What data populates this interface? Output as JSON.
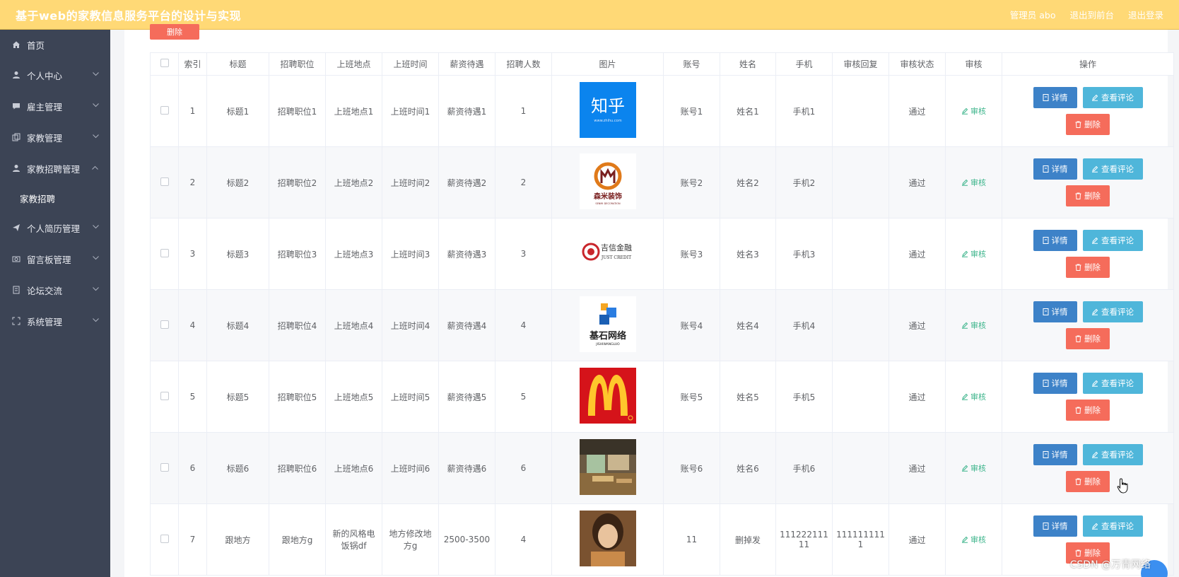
{
  "header": {
    "title": "基于web的家教信息服务平台的设计与实现",
    "user": "管理员 abo",
    "frontend": "退出到前台",
    "logout": "退出登录"
  },
  "sidebar": {
    "items": [
      {
        "label": "首页",
        "icon": "home-icon"
      },
      {
        "label": "个人中心",
        "icon": "user-icon"
      },
      {
        "label": "雇主管理",
        "icon": "chat-icon"
      },
      {
        "label": "家教管理",
        "icon": "copy-icon"
      },
      {
        "label": "家教招聘管理",
        "icon": "user-icon",
        "open": true,
        "children": [
          "家教招聘"
        ]
      },
      {
        "label": "个人简历管理",
        "icon": "send-icon"
      },
      {
        "label": "留言板管理",
        "icon": "camera-icon"
      },
      {
        "label": "论坛交流",
        "icon": "building-icon"
      },
      {
        "label": "系统管理",
        "icon": "scan-icon"
      }
    ]
  },
  "table": {
    "top_delete_label": "删除",
    "headers": [
      "索引",
      "标题",
      "招聘职位",
      "上班地点",
      "上班时间",
      "薪资待遇",
      "招聘人数",
      "图片",
      "账号",
      "姓名",
      "手机",
      "审核回复",
      "审核状态",
      "审核",
      "操作"
    ],
    "rows": [
      {
        "index": "1",
        "title": "标题1",
        "position": "招聘职位1",
        "location": "上班地点1",
        "time": "上班时间1",
        "salary": "薪资待遇1",
        "count": "1",
        "image": "zhihu-logo",
        "account": "账号1",
        "name": "姓名1",
        "phone": "手机1",
        "reply": "",
        "status": "通过"
      },
      {
        "index": "2",
        "title": "标题2",
        "position": "招聘职位2",
        "location": "上班地点2",
        "time": "上班时间2",
        "salary": "薪资待遇2",
        "count": "2",
        "image": "decoration-logo",
        "account": "账号2",
        "name": "姓名2",
        "phone": "手机2",
        "reply": "",
        "status": "通过"
      },
      {
        "index": "3",
        "title": "标题3",
        "position": "招聘职位3",
        "location": "上班地点3",
        "time": "上班时间3",
        "salary": "薪资待遇3",
        "count": "3",
        "image": "just-credit-logo",
        "account": "账号3",
        "name": "姓名3",
        "phone": "手机3",
        "reply": "",
        "status": "通过"
      },
      {
        "index": "4",
        "title": "标题4",
        "position": "招聘职位4",
        "location": "上班地点4",
        "time": "上班时间4",
        "salary": "薪资待遇4",
        "count": "4",
        "image": "jishi-logo",
        "account": "账号4",
        "name": "姓名4",
        "phone": "手机4",
        "reply": "",
        "status": "通过"
      },
      {
        "index": "5",
        "title": "标题5",
        "position": "招聘职位5",
        "location": "上班地点5",
        "time": "上班时间5",
        "salary": "薪资待遇5",
        "count": "5",
        "image": "mcdonalds-logo",
        "account": "账号5",
        "name": "姓名5",
        "phone": "手机5",
        "reply": "",
        "status": "通过"
      },
      {
        "index": "6",
        "title": "标题6",
        "position": "招聘职位6",
        "location": "上班地点6",
        "time": "上班时间6",
        "salary": "薪资待遇6",
        "count": "6",
        "image": "interior-photo",
        "account": "账号6",
        "name": "姓名6",
        "phone": "手机6",
        "reply": "",
        "status": "通过"
      },
      {
        "index": "7",
        "title": "跟地方",
        "position": "跟地方g",
        "location": "新的风格电饭锅df",
        "time": "地方修改地方g",
        "salary": "2500-3500",
        "count": "4",
        "image": "portrait-photo",
        "account": "11",
        "name": "删掉发",
        "phone": "11122211111",
        "reply": "1111111111",
        "status": "通过"
      }
    ],
    "audit_label": "审核",
    "detail_label": "详情",
    "comment_label": "查看评论",
    "delete_label": "删除"
  },
  "logo_texts": {
    "zhihu": "知乎",
    "zhihu_url": "www.zhihu.com",
    "decor_cn": "森米装饰",
    "decor_en": "SENMI DECORATION",
    "credit_cn": "吉信金融",
    "credit_en": "JUST CREDIT",
    "jishi_cn": "基石网络",
    "jishi_en": "JISHIWANGLUO"
  },
  "watermark": "CSDN @万青网络",
  "colors": {
    "header_bg": "#ffd976",
    "sidebar_bg": "#3c4455",
    "detail_btn": "#3d82c8",
    "comment_btn": "#4fb6da",
    "delete_btn": "#f56c5b",
    "audit_link": "#3eb58c"
  }
}
